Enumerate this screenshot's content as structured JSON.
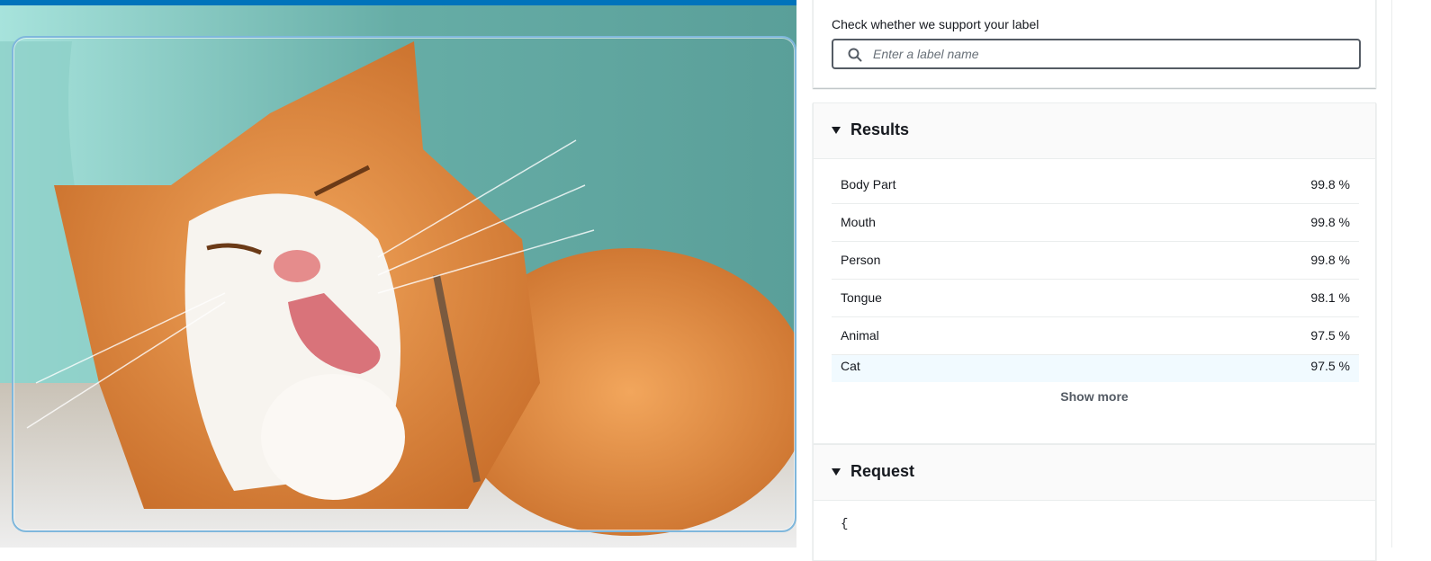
{
  "search": {
    "label": "Check whether we support your label",
    "placeholder": "Enter a label name",
    "value": ""
  },
  "results": {
    "title": "Results",
    "rows": [
      {
        "label": "Body Part",
        "confidence": "99.8 %"
      },
      {
        "label": "Mouth",
        "confidence": "99.8 %"
      },
      {
        "label": "Person",
        "confidence": "99.8 %"
      },
      {
        "label": "Tongue",
        "confidence": "98.1 %"
      },
      {
        "label": "Animal",
        "confidence": "97.5 %"
      },
      {
        "label": "Cat",
        "confidence": "97.5 %"
      }
    ],
    "show_more": "Show more"
  },
  "request": {
    "title": "Request",
    "code_first_line": "{"
  },
  "colors": {
    "accent_bar": "#0073bb",
    "bounding_box": "#7fb7dc",
    "highlight_row": "#f1faff"
  }
}
